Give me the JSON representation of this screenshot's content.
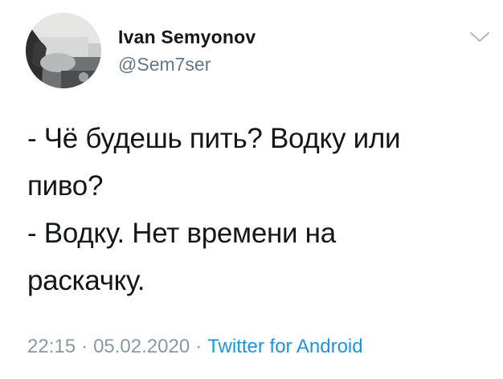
{
  "author": {
    "display_name": "Ivan Semyonov",
    "handle": "@Sem7ser",
    "avatar_icon": "user-avatar-photo"
  },
  "menu": {
    "icon": "chevron-down-icon",
    "color": "#aab8c2"
  },
  "tweet": {
    "lines": [
      "- Чё будешь пить? Водку или",
      "пиво?",
      "- Водку. Нет времени на",
      "раскачку."
    ]
  },
  "meta": {
    "time": "22:15",
    "date": "05.02.2020",
    "separator": "·",
    "source": "Twitter for Android"
  },
  "colors": {
    "text": "#14171a",
    "secondary": "#657786",
    "meta": "#8899a6",
    "link": "#1b95e0"
  }
}
